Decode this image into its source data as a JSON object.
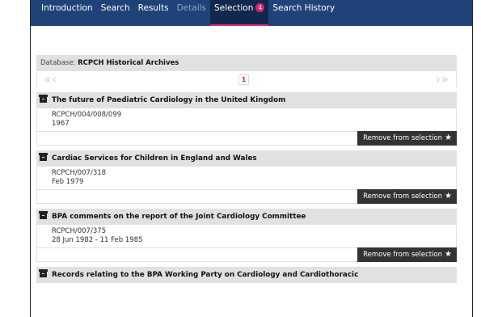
{
  "nav": {
    "tabs": [
      {
        "label": "Introduction"
      },
      {
        "label": "Search"
      },
      {
        "label": "Results"
      },
      {
        "label": "Details"
      },
      {
        "label": "Selection"
      },
      {
        "label": "Search History"
      }
    ],
    "selection_count": "4"
  },
  "database": {
    "prefix": "Database:",
    "name": "RCPCH Historical Archives"
  },
  "pager": {
    "first_prev": "«‹",
    "next_last": "›»",
    "current_page": "1"
  },
  "remove_label": "Remove from selection",
  "records": [
    {
      "title": "The future of Paediatric Cardiology in the United Kingdom",
      "ref": "RCPCH/004/008/099",
      "date": "1967"
    },
    {
      "title": "Cardiac Services for Children in England and Wales",
      "ref": "RCPCH/007/318",
      "date": "Feb 1979"
    },
    {
      "title": "BPA comments on the report of the Joint Cardiology Committee",
      "ref": "RCPCH/007/375",
      "date": "28 Jun 1982 - 11 Feb 1985"
    },
    {
      "title": "Records relating to the BPA Working Party on Cardiology and Cardiothoracic"
    }
  ],
  "colors": {
    "navbar": "#1f4378",
    "accent": "#d6246e",
    "header_bg": "#e1e1e1",
    "button_bg": "#333333"
  }
}
